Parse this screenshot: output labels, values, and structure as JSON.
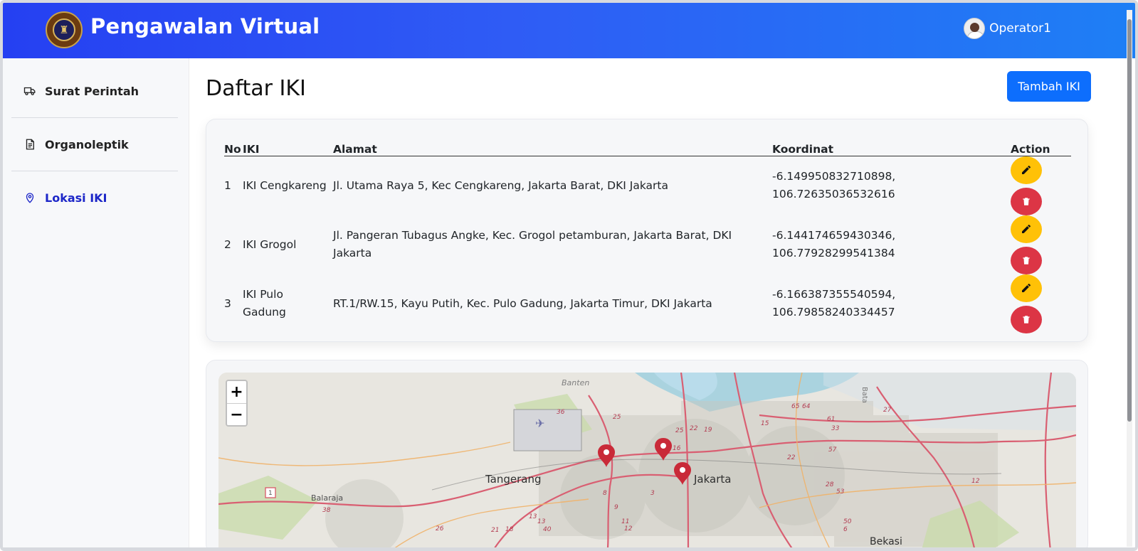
{
  "app": {
    "brand": "Pengawalan Virtual",
    "user_name": "Operator1",
    "colors": {
      "primary": "#0d6efd",
      "active_nav": "#1d27c8",
      "edit": "#ffc107",
      "delete": "#dc3545"
    }
  },
  "sidebar": {
    "items": [
      {
        "label": "Surat Perintah",
        "icon": "truck-icon"
      },
      {
        "label": "Organoleptik",
        "icon": "document-icon"
      },
      {
        "label": "Lokasi IKI",
        "icon": "map-pin-icon"
      }
    ]
  },
  "main": {
    "title": "Daftar IKI",
    "add_button": "Tambah IKI",
    "table": {
      "headers": [
        "No",
        "IKI",
        "Alamat",
        "Koordinat",
        "Action"
      ],
      "rows": [
        {
          "no": "1",
          "iki": "IKI Cengkareng",
          "alamat": "Jl. Utama Raya 5, Kec Cengkareng, Jakarta Barat, DKI Jakarta",
          "koordinat": "-6.149950832710898, 106.72635036532616"
        },
        {
          "no": "2",
          "iki": "IKI Grogol",
          "alamat": "Jl. Pangeran Tubagus Angke, Kec. Grogol petamburan, Jakarta Barat, DKI Jakarta",
          "koordinat": "-6.144174659430346, 106.77928299541384"
        },
        {
          "no": "3",
          "iki": "IKI Pulo Gadung",
          "alamat": "RT.1/RW.15, Kayu Putih, Kec. Pulo Gadung, Jakarta Timur, DKI Jakarta",
          "koordinat": "-6.166387355540594, 106.79858240334457"
        }
      ]
    },
    "map": {
      "zoom_in": "+",
      "zoom_out": "−",
      "labels": [
        "Banten",
        "Tangerang",
        "Jakarta",
        "Balaraja",
        "Bekasi",
        "Bata"
      ],
      "road_numbers": [
        "36",
        "25",
        "25",
        "22",
        "19",
        "15",
        "16",
        "65",
        "64",
        "61",
        "33",
        "57",
        "27",
        "22",
        "28",
        "53",
        "12",
        "50",
        "6",
        "8",
        "3",
        "9",
        "13",
        "21",
        "18",
        "40",
        "26",
        "38",
        "12",
        "13",
        "11",
        "1"
      ]
    }
  }
}
